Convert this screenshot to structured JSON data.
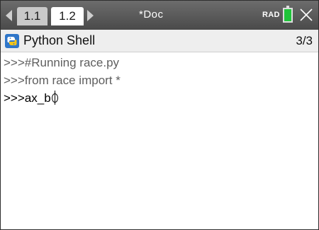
{
  "header": {
    "tabs": [
      {
        "label": "1.1",
        "active": false
      },
      {
        "label": "1.2",
        "active": true
      }
    ],
    "document_title": "*Doc",
    "angle_mode": "RAD",
    "battery_icon": "battery-icon",
    "close_icon": "close-icon"
  },
  "shell": {
    "icon": "python-icon",
    "title": "Python Shell",
    "page_count": "3/3"
  },
  "console": {
    "lines": [
      ">>>#Running race.py",
      ">>>from race import *",
      ">>>ax_b"
    ]
  },
  "colors": {
    "topbar": "#5a5a5a",
    "shell_header": "#eeeeee",
    "battery": "#1fc43a",
    "history_text": "#5e5e5e",
    "current_text": "#000000"
  }
}
